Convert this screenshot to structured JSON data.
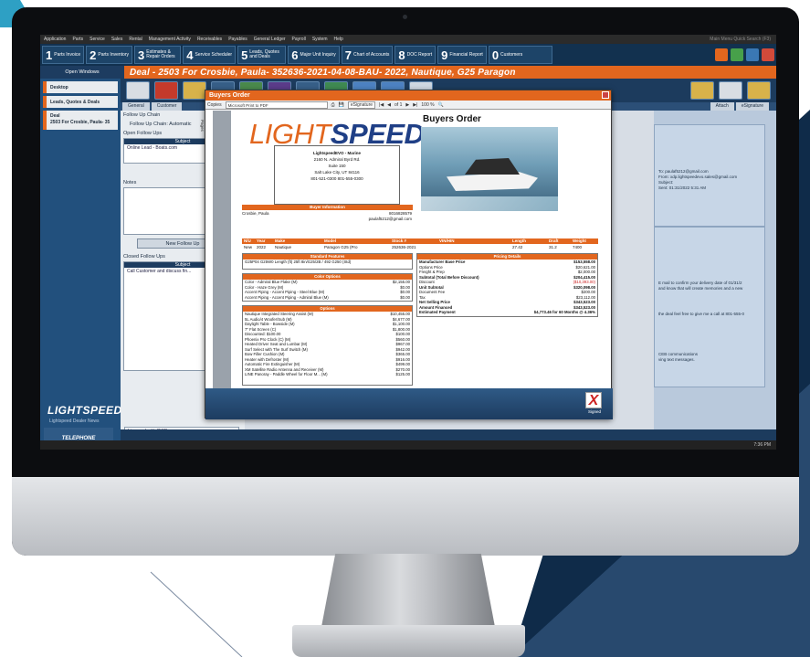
{
  "menu": [
    "Application",
    "Parts",
    "Service",
    "Sales",
    "Rental",
    "Management Activity",
    "Receivables",
    "Payables",
    "General Ledger",
    "Payroll",
    "System",
    "Help"
  ],
  "top_nav": [
    {
      "num": "1",
      "label": "Parts Invoice"
    },
    {
      "num": "2",
      "label": "Parts Inventory"
    },
    {
      "num": "3",
      "label": "Estimates & Repair Orders"
    },
    {
      "num": "4",
      "label": "Service Scheduler"
    },
    {
      "num": "5",
      "label": "Leads, Quotes and Deals"
    },
    {
      "num": "6",
      "label": "Major Unit Inquiry"
    },
    {
      "num": "7",
      "label": "Chart of Accounts"
    },
    {
      "num": "8",
      "label": "DOC Report"
    },
    {
      "num": "9",
      "label": "Financial Report"
    },
    {
      "num": "0",
      "label": "Customers"
    }
  ],
  "menubar_right": "Main Menu Quick Search (F3)",
  "open_windows": "Open Windows",
  "deal_title": "Deal - 2503 For Crosbie, Paula- 352636-2021-04-08-BAU- 2022, Nautique, G25 Paragon",
  "sidebar": {
    "items": [
      "Desktop",
      "Leads, Quotes & Deals"
    ],
    "deal_item_line1": "Deal",
    "deal_item_line2": "2503 For Crosbie, Paula- 35",
    "logo": "LIGHTSPEED",
    "logo_sub": "Lightspeed Dealer News",
    "tele_text": "TELEPHONE INTEGRATION NOW AVAILABLE"
  },
  "tabs": [
    "General",
    "Customer"
  ],
  "right_tabs": [
    "Attach",
    "eSignature"
  ],
  "left_panel": {
    "follow_up": "Follow Up Chain",
    "follow_up_row": "Follow Up Chain: Automatic",
    "open_follow": "Open Follow Ups",
    "subject": "Subject",
    "subject_row": "Online Lead - Boats.com",
    "notes": "Notes",
    "new_follow": "New Follow Up",
    "closed_follow": "Closed Follow Ups",
    "closed_subject": "Subject",
    "closed_row": "Call Customer and discuss fin...",
    "license": "Licensed with CISB"
  },
  "email": {
    "to": "To: paulaf5212@gmail.com",
    "from": "From: xdp.lightspeedevo.sales@gmail.com",
    "subject": "Subject:",
    "sent": "Sent: 01:31/2022 5:31 AM",
    "body1": "E mail to confirm your delivery date of 01/31/2",
    "body2": "and know that will create memories and a new",
    "body3": "the deal feel free to give me a call at 801-555-0",
    "body4": "CEB communications",
    "body5": "ving text messages."
  },
  "modal": {
    "title": "Buyers Order",
    "copies": "Copies",
    "printer": "Microsoft Print to PDF",
    "esig": "eSignature",
    "page_label": "Pages",
    "pages": "of 1",
    "zoom": "100 %",
    "sign_label": "Signed"
  },
  "doc": {
    "logo_a": "LIGHT",
    "logo_b": "SPEED",
    "title": "Buyers Order",
    "dealer": "LightspeedEVO - Marine",
    "addr1": "2160 N. Admiral Byrd Rd.",
    "addr2": "Suite 150",
    "addr3": "Salt Lake City, UT 84116",
    "phone": "801-521-0300  801-555-0300",
    "buyer_info": "Buyer Information",
    "buyer_name": "Crosbie, Paula",
    "buyer_phone": "8016828579",
    "buyer_email": "paulaf5212@gmail.com",
    "vehicle_headers": [
      "N/U",
      "Year",
      "Make",
      "Model",
      "Stock #",
      "VIN/HIN",
      "Length",
      "Draft",
      "Weight"
    ],
    "vehicle_row": [
      "New",
      "2022",
      "Nautique",
      "Paragon G25 (Pro",
      "252636-2021",
      "",
      "27.42",
      "31.2",
      "7400"
    ],
    "standard_features": "Standard Features",
    "std_text": "G25P04 G25W0 Length (ft) 25ft 8in/G25/2B / 492 G250 (Std)",
    "color_options": "Color Options",
    "colors": [
      {
        "n": "Color - Admiral Blue Flake (M)",
        "v": "$2,155.00"
      },
      {
        "n": "Color - Haze Grey (M)",
        "v": "$0.00"
      },
      {
        "n": "Accent Piping - Accent Piping - Steel Blue (M)",
        "v": "$0.00"
      },
      {
        "n": "Accent Piping - Accent Piping - Admiral Blue (M)",
        "v": "$0.00"
      }
    ],
    "options": "Options",
    "opts": [
      {
        "n": "Nautique Integrated Steering Assist (M)",
        "v": "$10,455.00"
      },
      {
        "n": "5L Audio/4 Woofer/Sub (M)",
        "v": "$4,677.00"
      },
      {
        "n": "Daylight Table - Bowside (M)",
        "v": "$1,100.00"
      },
      {
        "n": "7\" Flat Screen (C)",
        "v": "$1,800.00"
      },
      {
        "n": "  Discounted: $100.00",
        "v": "$100.00"
      },
      {
        "n": "Phoenix Pro Clock (C) (M)",
        "v": "$560.00"
      },
      {
        "n": "Heated Driver Seat and Lumbar (M)",
        "v": "$967.00"
      },
      {
        "n": "Surf Select with The Surf Switch (M)",
        "v": "$942.00"
      },
      {
        "n": "Bow Filler Cushion (M)",
        "v": "$365.00"
      },
      {
        "n": "Heater with Defroster (M)",
        "v": "$916.00"
      },
      {
        "n": "Automatic Fire Extinguisher (M)",
        "v": "$499.00"
      },
      {
        "n": "XM Satellite Radio Antenna and Receiver (M)",
        "v": "$270.00"
      },
      {
        "n": "LINE Panoray - Paddle Wheel for Floor M... (M)",
        "v": "$125.00"
      }
    ],
    "pricing_details": "Pricing Details",
    "pricing": [
      {
        "n": "Manufacturer Base Price",
        "v": "$153,558.00",
        "b": true
      },
      {
        "n": "  Options Price",
        "v": "$20,621.00",
        "b": false
      },
      {
        "n": "  Freight & Prep",
        "v": "$2,000.00",
        "b": false
      },
      {
        "n": "Subtotal (Total Before Discount)",
        "v": "$204,415.00",
        "b": true
      },
      {
        "n": "  Discount",
        "v": "($10,393.00)",
        "b": false,
        "red": true
      },
      {
        "n": "Unit Subtotal",
        "v": "$320,098.00",
        "b": true
      },
      {
        "n": "  Document Fee",
        "v": "$200.00",
        "b": false
      },
      {
        "n": "  Tax",
        "v": "$23,112.00",
        "b": false
      },
      {
        "n": "Net Selling Price",
        "v": "$343,523.00",
        "b": true
      },
      {
        "n": "Amount Financed",
        "v": "$343,523.00",
        "b": true
      },
      {
        "n": "Estimated Payment",
        "v": "$4,773.46 for 60 Months @ 4.36%",
        "b": true
      }
    ]
  },
  "taskbar_time": "7:36 PM",
  "colors": {
    "accent": "#e2661e",
    "navy": "#1d3c60"
  }
}
